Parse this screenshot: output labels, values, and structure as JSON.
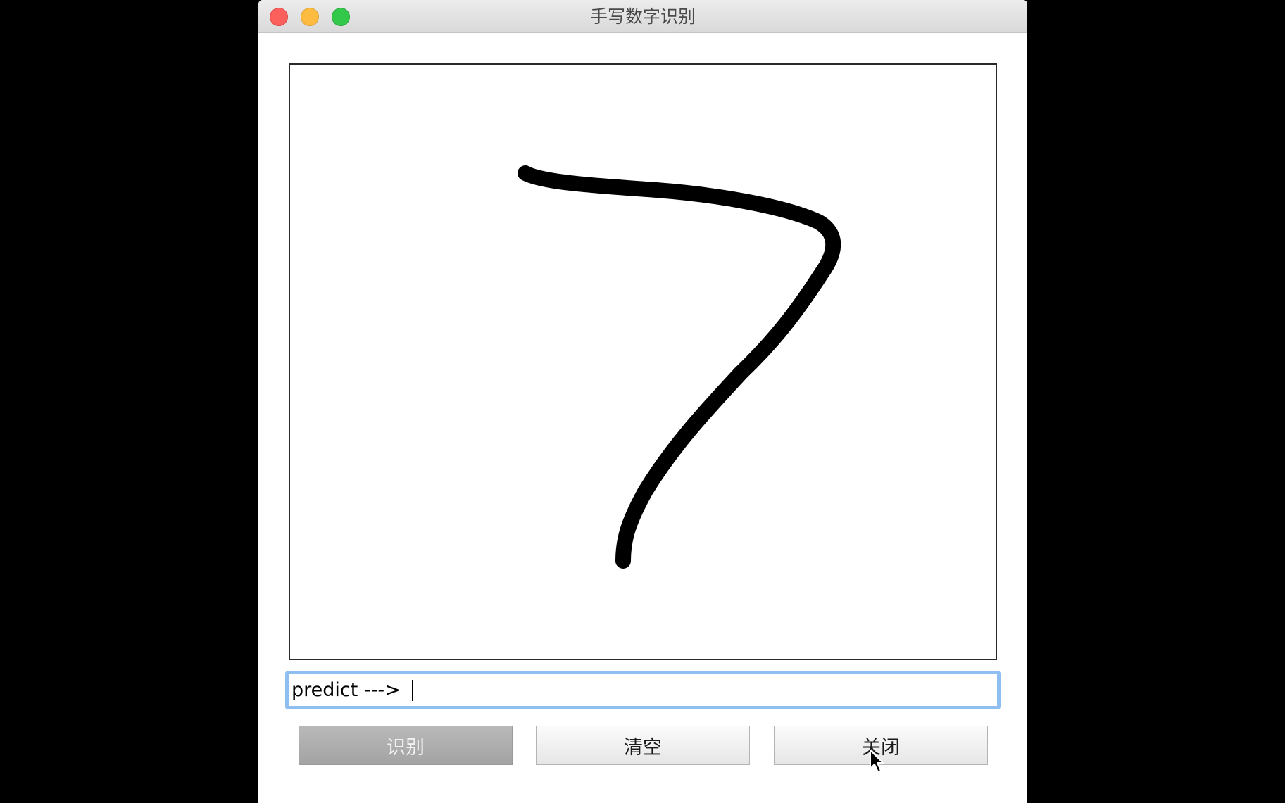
{
  "window": {
    "title": "手写数字识别"
  },
  "prediction_field": {
    "value": "predict ---> "
  },
  "buttons": {
    "recognize_label": "识别",
    "clear_label": "清空",
    "close_label": "关闭"
  },
  "colors": {
    "focus_ring": "#8ebff0",
    "ink": "#000000",
    "traffic_close": "#fc605c",
    "traffic_minimize": "#fdbc40",
    "traffic_zoom": "#34c84a"
  },
  "icons": [
    "close-window-icon",
    "minimize-window-icon",
    "zoom-window-icon",
    "mouse-pointer-icon"
  ]
}
